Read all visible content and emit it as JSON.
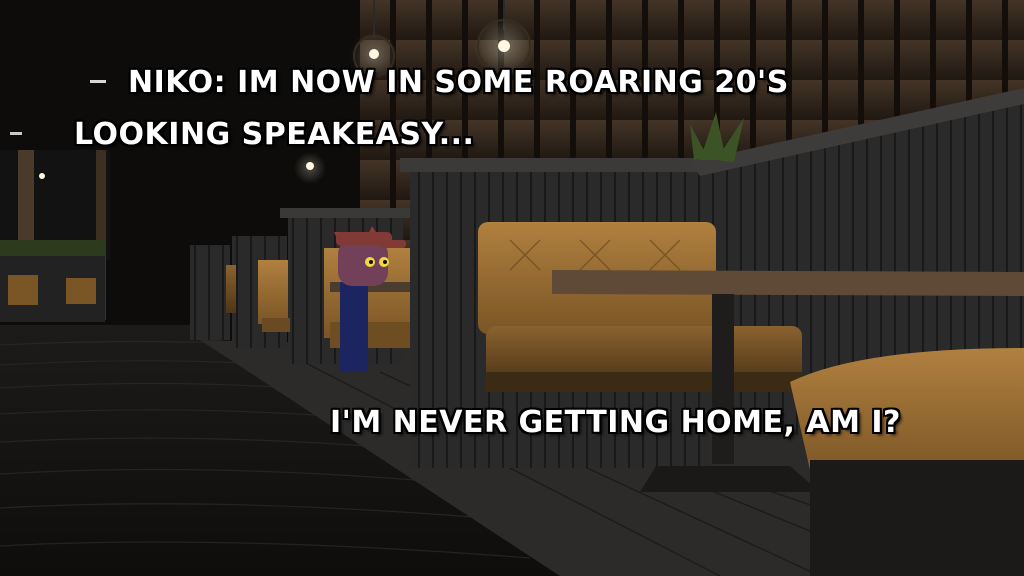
{
  "captions": {
    "line1": "NIKO: IM NOW IN SOME ROARING 20'S",
    "line2": "LOOKING SPEAKEASY...",
    "line3": "I'M NEVER GETTING HOME, AM I?"
  },
  "icons": {
    "character": "niko-character-sprite",
    "light": "hanging-bulb-lamp"
  },
  "colors": {
    "caption_text": "#ffffff",
    "caption_outline": "#000000",
    "booth_leather": "#a07438",
    "wall_wood": "#6b5440",
    "carpet": "#1a1918"
  }
}
